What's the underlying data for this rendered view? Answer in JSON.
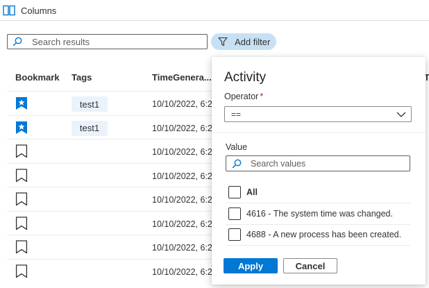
{
  "toolbar": {
    "columns_label": "Columns"
  },
  "search": {
    "placeholder": "Search results",
    "value": ""
  },
  "add_filter": {
    "label": "Add filter"
  },
  "table": {
    "headers": {
      "bookmark": "Bookmark",
      "tags": "Tags",
      "time": "TimeGenera...",
      "next": "T"
    },
    "rows": [
      {
        "bookmarked": true,
        "tag": "test1",
        "time": "10/10/2022, 6:2"
      },
      {
        "bookmarked": true,
        "tag": "test1",
        "time": "10/10/2022, 6:2"
      },
      {
        "bookmarked": false,
        "tag": "",
        "time": "10/10/2022, 6:2"
      },
      {
        "bookmarked": false,
        "tag": "",
        "time": "10/10/2022, 6:2"
      },
      {
        "bookmarked": false,
        "tag": "",
        "time": "10/10/2022, 6:2"
      },
      {
        "bookmarked": false,
        "tag": "",
        "time": "10/10/2022, 6:2"
      },
      {
        "bookmarked": false,
        "tag": "",
        "time": "10/10/2022, 6:2"
      },
      {
        "bookmarked": false,
        "tag": "",
        "time": "10/10/2022, 6:2"
      }
    ]
  },
  "filter_panel": {
    "title": "Activity",
    "operator_label": "Operator",
    "required_mark": "*",
    "operator_value": "==",
    "value_label": "Value",
    "search_placeholder": "Search values",
    "options": [
      {
        "label": "All",
        "checked": false
      },
      {
        "label": "4616 - The system time was changed.",
        "checked": false
      },
      {
        "label": "4688 - A new process has been created.",
        "checked": false
      }
    ],
    "apply_label": "Apply",
    "cancel_label": "Cancel"
  },
  "colors": {
    "accent": "#0078d4",
    "pill_bg": "#c7e0f4",
    "tag_bg": "#eaf2fb",
    "bookmark_fill": "#0078d4"
  },
  "icons": {
    "columns": "columns-icon",
    "search": "search-icon",
    "filter": "filter-icon",
    "bookmark_filled": "bookmark-filled-icon",
    "bookmark_outline": "bookmark-outline-icon",
    "chevron": "chevron-down-icon"
  }
}
